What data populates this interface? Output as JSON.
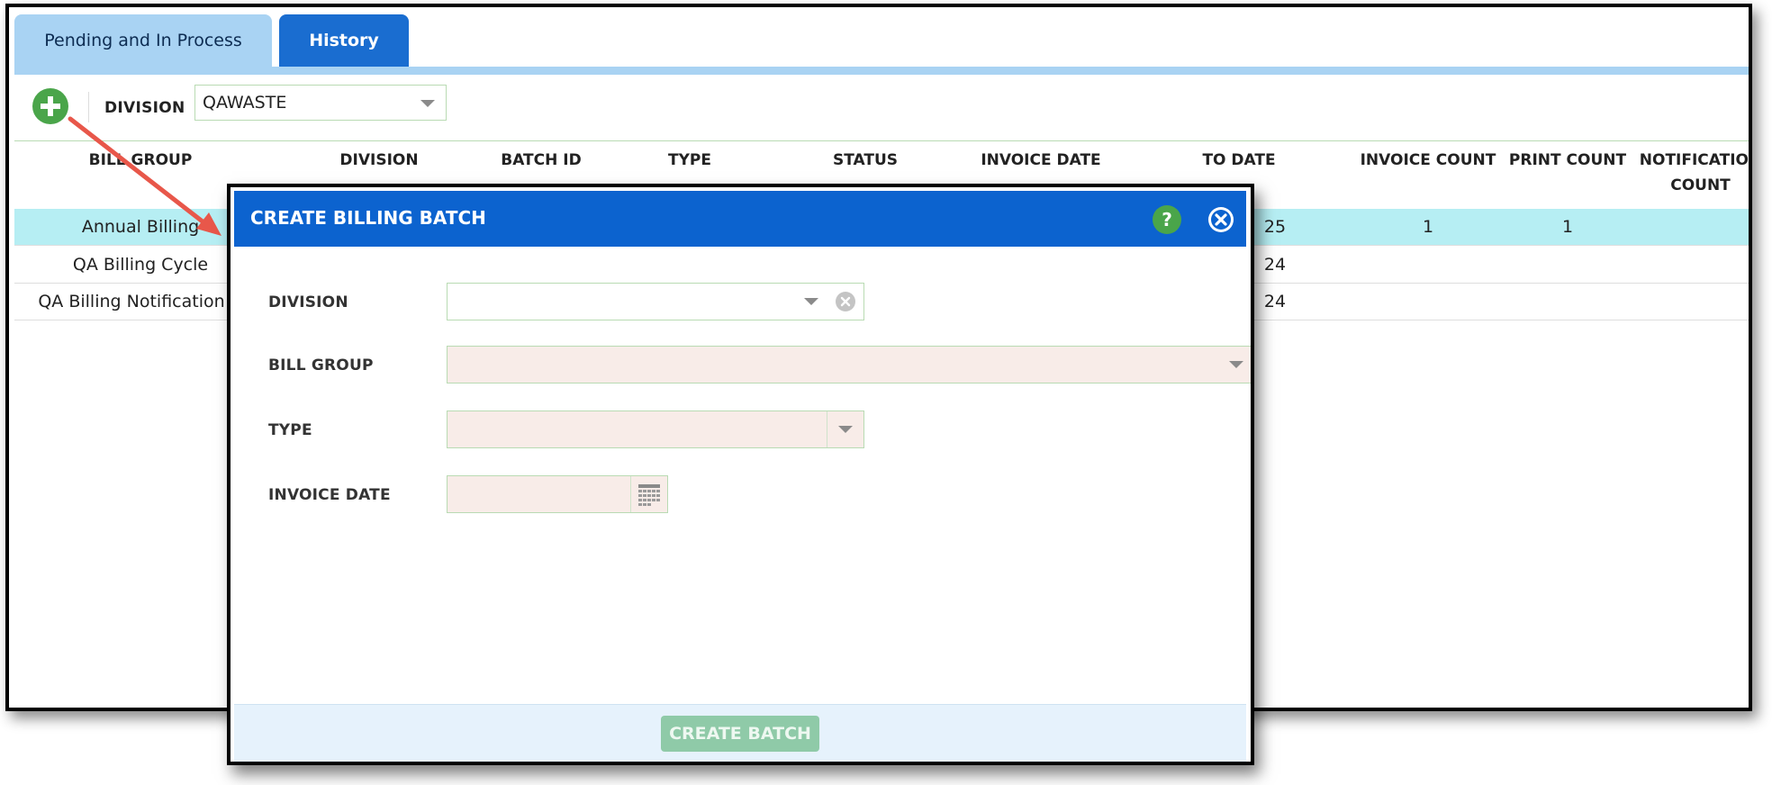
{
  "tabs": {
    "pending_label": "Pending and In Process",
    "history_label": "History"
  },
  "toolbar": {
    "division_label": "DIVISION",
    "division_value": "QAWASTE"
  },
  "grid": {
    "columns": {
      "bill_group": "BILL GROUP",
      "division": "DIVISION",
      "batch_id": "BATCH ID",
      "type": "TYPE",
      "status": "STATUS",
      "invoice_date": "INVOICE DATE",
      "to_date": "TO DATE",
      "invoice_count": "INVOICE COUNT",
      "print_count": "PRINT COUNT",
      "notification_count_line1": "NOTIFICATION",
      "notification_count_line2": "COUNT"
    },
    "rows": [
      {
        "bill_group": "Annual Billing",
        "to_date_partial": "25",
        "invoice_count": "1",
        "print_count": "1"
      },
      {
        "bill_group": "QA Billing Cycle",
        "to_date_partial": "24",
        "invoice_count": "",
        "print_count": ""
      },
      {
        "bill_group": "QA Billing Notification",
        "to_date_partial": "24",
        "invoice_count": "",
        "print_count": ""
      }
    ]
  },
  "modal": {
    "title": "CREATE BILLING BATCH",
    "help_label": "?",
    "fields": {
      "division_label": "DIVISION",
      "division_value": "",
      "bill_group_label": "BILL GROUP",
      "bill_group_value": "",
      "type_label": "TYPE",
      "type_value": "",
      "invoice_date_label": "INVOICE DATE",
      "invoice_date_value": ""
    },
    "create_button_label": "CREATE BATCH"
  },
  "colors": {
    "header_blue": "#0c63cf",
    "tab_light": "#a9d3f3",
    "selected_row": "#b6eef3",
    "required_field": "#f8ece8",
    "add_green": "#4aa54a",
    "annotation_arrow": "#e8574a",
    "disabled_button": "#8fcaa8"
  },
  "icons": [
    "plus-circle-icon",
    "help-icon",
    "close-circle-icon",
    "clear-circle-icon",
    "calendar-icon",
    "chevron-down-icon"
  ]
}
